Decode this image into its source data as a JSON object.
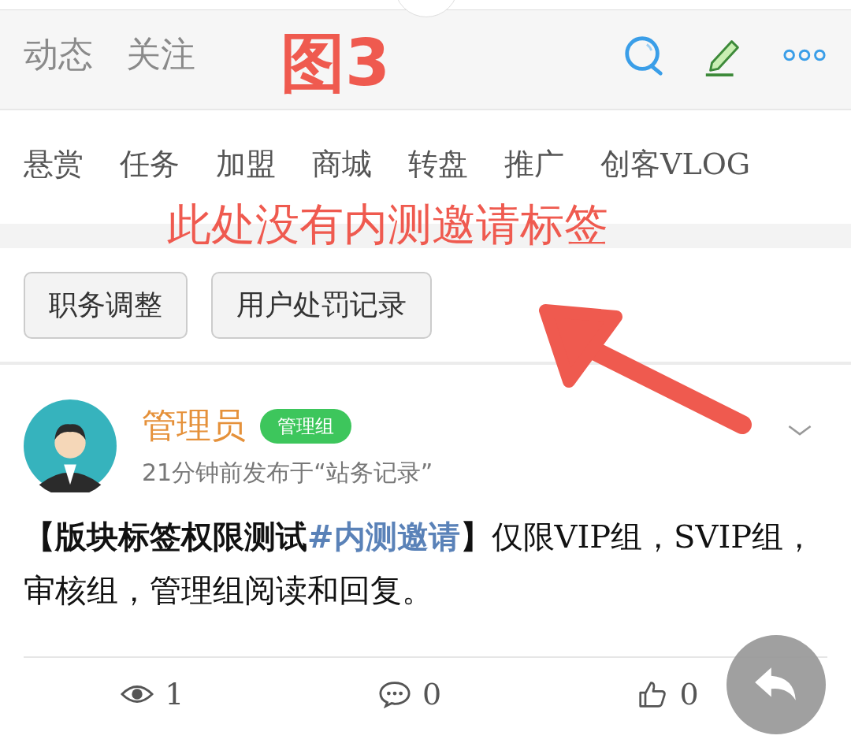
{
  "header": {
    "tabs": [
      {
        "label": "动态",
        "selected": false
      },
      {
        "label": "关注",
        "selected": false
      }
    ],
    "annotation": "图3"
  },
  "categories": [
    "悬赏",
    "任务",
    "加盟",
    "商城",
    "转盘",
    "推广",
    "创客VLOG"
  ],
  "annotation_note": "此处没有内测邀请标签",
  "buttons": [
    "职务调整",
    "用户处罚记录"
  ],
  "post": {
    "author": "管理员",
    "badge": "管理组",
    "meta": "21分钟前发布于“站务记录”",
    "title_prefix": "【版块标签权限测试",
    "topic": "#内测邀请",
    "title_suffix": "】",
    "body": "仅限VIP组，SVIP组，审核组，管理组阅读和回复。",
    "stats": [
      {
        "kind": "views",
        "count": "1"
      },
      {
        "kind": "comments",
        "count": "0"
      },
      {
        "kind": "likes",
        "count": "0"
      }
    ]
  }
}
